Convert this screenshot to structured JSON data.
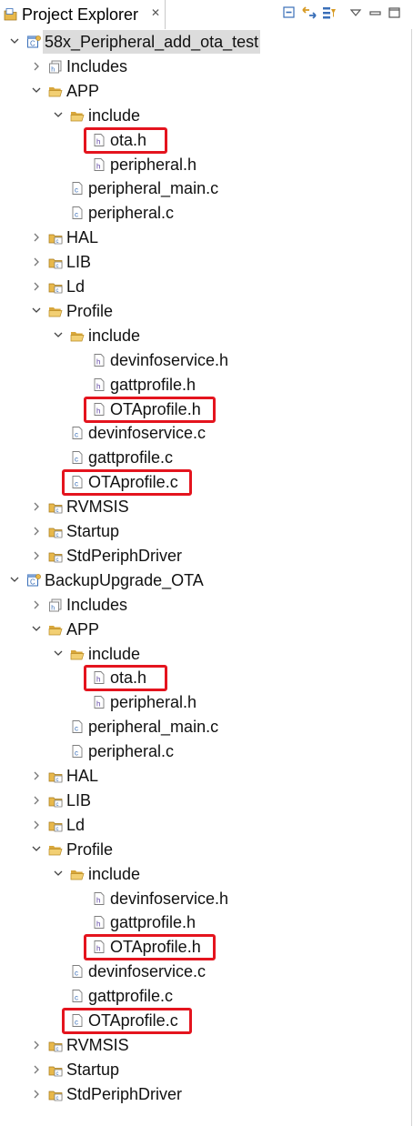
{
  "view": {
    "title": "Project Explorer",
    "close_glyph": "✕",
    "toolbar": [
      "collapse-all-icon",
      "link-with-editor-icon",
      "filters-icon",
      "view-menu-icon",
      "minimize-icon",
      "maximize-icon"
    ]
  },
  "tree": [
    {
      "label": "58x_Peripheral_add_ota_test",
      "icon": "project-icon",
      "state": "expanded",
      "depth": 0,
      "selected": true
    },
    {
      "label": "Includes",
      "icon": "includes-icon",
      "state": "collapsed",
      "depth": 1
    },
    {
      "label": "APP",
      "icon": "folder-open-icon",
      "state": "expanded",
      "depth": 1
    },
    {
      "label": "include",
      "icon": "folder-open-icon",
      "state": "expanded",
      "depth": 2
    },
    {
      "label": "ota.h",
      "icon": "header-file-icon",
      "state": "leaf",
      "depth": 3,
      "highlighted": true
    },
    {
      "label": "peripheral.h",
      "icon": "header-file-icon",
      "state": "leaf",
      "depth": 3
    },
    {
      "label": "peripheral_main.c",
      "icon": "c-file-icon",
      "state": "leaf",
      "depth": 2
    },
    {
      "label": "peripheral.c",
      "icon": "c-file-icon",
      "state": "leaf",
      "depth": 2
    },
    {
      "label": "HAL",
      "icon": "source-folder-icon",
      "state": "collapsed",
      "depth": 1
    },
    {
      "label": "LIB",
      "icon": "source-folder-icon",
      "state": "collapsed",
      "depth": 1
    },
    {
      "label": "Ld",
      "icon": "source-folder-icon",
      "state": "collapsed",
      "depth": 1
    },
    {
      "label": "Profile",
      "icon": "folder-open-icon",
      "state": "expanded",
      "depth": 1
    },
    {
      "label": "include",
      "icon": "folder-open-icon",
      "state": "expanded",
      "depth": 2
    },
    {
      "label": "devinfoservice.h",
      "icon": "header-file-icon",
      "state": "leaf",
      "depth": 3
    },
    {
      "label": "gattprofile.h",
      "icon": "header-file-icon",
      "state": "leaf",
      "depth": 3
    },
    {
      "label": "OTAprofile.h",
      "icon": "header-file-icon",
      "state": "leaf",
      "depth": 3,
      "highlighted": true
    },
    {
      "label": "devinfoservice.c",
      "icon": "c-file-icon",
      "state": "leaf",
      "depth": 2
    },
    {
      "label": "gattprofile.c",
      "icon": "c-file-icon",
      "state": "leaf",
      "depth": 2
    },
    {
      "label": "OTAprofile.c",
      "icon": "c-file-icon",
      "state": "leaf",
      "depth": 2,
      "highlighted": true
    },
    {
      "label": "RVMSIS",
      "icon": "source-folder-icon",
      "state": "collapsed",
      "depth": 1
    },
    {
      "label": "Startup",
      "icon": "source-folder-icon",
      "state": "collapsed",
      "depth": 1
    },
    {
      "label": "StdPeriphDriver",
      "icon": "source-folder-icon",
      "state": "collapsed",
      "depth": 1
    },
    {
      "label": "BackupUpgrade_OTA",
      "icon": "project-icon",
      "state": "expanded",
      "depth": 0
    },
    {
      "label": "Includes",
      "icon": "includes-icon",
      "state": "collapsed",
      "depth": 1
    },
    {
      "label": "APP",
      "icon": "folder-open-icon",
      "state": "expanded",
      "depth": 1
    },
    {
      "label": "include",
      "icon": "folder-open-icon",
      "state": "expanded",
      "depth": 2
    },
    {
      "label": "ota.h",
      "icon": "header-file-icon",
      "state": "leaf",
      "depth": 3,
      "highlighted": true
    },
    {
      "label": "peripheral.h",
      "icon": "header-file-icon",
      "state": "leaf",
      "depth": 3
    },
    {
      "label": "peripheral_main.c",
      "icon": "c-file-icon",
      "state": "leaf",
      "depth": 2
    },
    {
      "label": "peripheral.c",
      "icon": "c-file-icon",
      "state": "leaf",
      "depth": 2
    },
    {
      "label": "HAL",
      "icon": "source-folder-icon",
      "state": "collapsed",
      "depth": 1
    },
    {
      "label": "LIB",
      "icon": "source-folder-icon",
      "state": "collapsed",
      "depth": 1
    },
    {
      "label": "Ld",
      "icon": "source-folder-icon",
      "state": "collapsed",
      "depth": 1
    },
    {
      "label": "Profile",
      "icon": "folder-open-icon",
      "state": "expanded",
      "depth": 1
    },
    {
      "label": "include",
      "icon": "folder-open-icon",
      "state": "expanded",
      "depth": 2
    },
    {
      "label": "devinfoservice.h",
      "icon": "header-file-icon",
      "state": "leaf",
      "depth": 3
    },
    {
      "label": "gattprofile.h",
      "icon": "header-file-icon",
      "state": "leaf",
      "depth": 3
    },
    {
      "label": "OTAprofile.h",
      "icon": "header-file-icon",
      "state": "leaf",
      "depth": 3,
      "highlighted": true
    },
    {
      "label": "devinfoservice.c",
      "icon": "c-file-icon",
      "state": "leaf",
      "depth": 2
    },
    {
      "label": "gattprofile.c",
      "icon": "c-file-icon",
      "state": "leaf",
      "depth": 2
    },
    {
      "label": "OTAprofile.c",
      "icon": "c-file-icon",
      "state": "leaf",
      "depth": 2,
      "highlighted": true
    },
    {
      "label": "RVMSIS",
      "icon": "source-folder-icon",
      "state": "collapsed",
      "depth": 1
    },
    {
      "label": "Startup",
      "icon": "source-folder-icon",
      "state": "collapsed",
      "depth": 1
    },
    {
      "label": "StdPeriphDriver",
      "icon": "source-folder-icon",
      "state": "collapsed",
      "depth": 1
    }
  ],
  "colors": {
    "highlight_box": "#e4141e",
    "selection": "#dcdcdc",
    "folder": "#e8b84b",
    "project_blue": "#3a6fb8"
  }
}
